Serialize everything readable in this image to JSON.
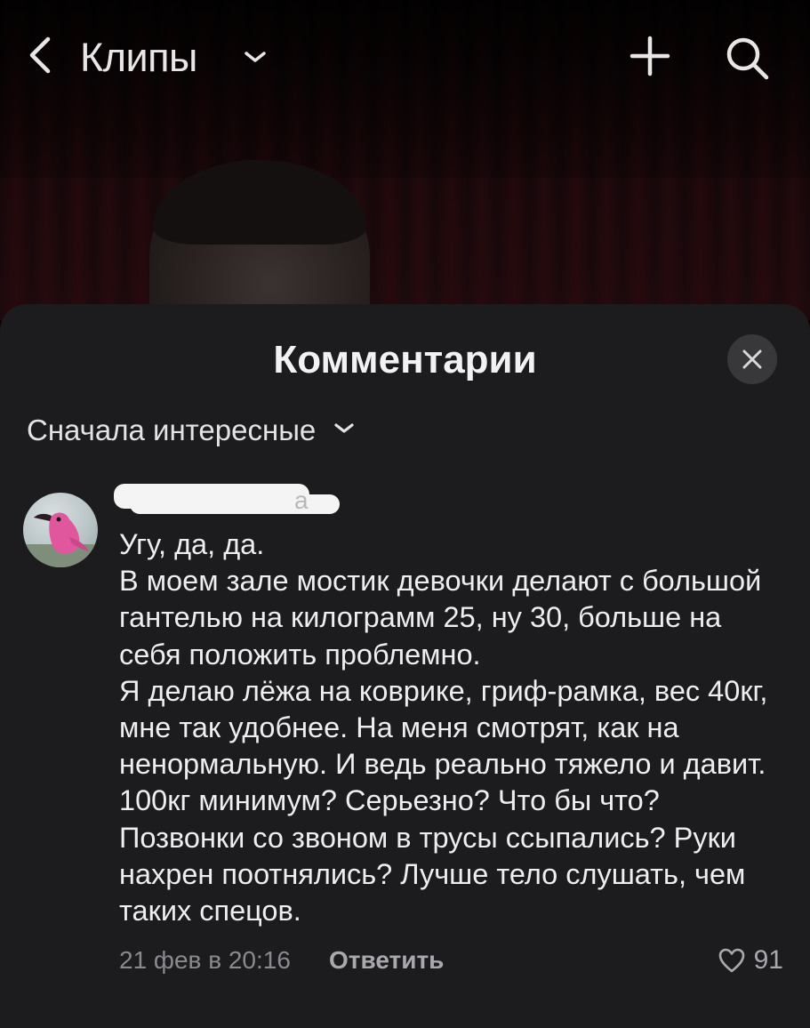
{
  "topbar": {
    "title": "Клипы",
    "back_icon": "chevron-left-icon",
    "title_dropdown_icon": "chevron-down-icon",
    "add_icon": "plus-icon",
    "search_icon": "search-icon"
  },
  "comments_sheet": {
    "title": "Комментарии",
    "close_icon": "close-icon",
    "sort": {
      "selected": "Сначала интересные",
      "dropdown_icon": "chevron-down-icon"
    },
    "comments": [
      {
        "username": "а",
        "avatar": "pink-crow-avatar",
        "text": "Угу, да, да.\nВ моем зале мостик девочки делают с большой гантелью на килограмм 25, ну 30, больше на себя положить проблемно.\nЯ делаю лёжа на коврике, гриф-рамка, вес 40кг, мне так удобнее. На меня смотрят, как на ненормальную. И ведь реально тяжело и давит.\n100кг минимум? Серьезно? Что бы что? Позвонки со звоном в трусы ссыпались? Руки нахрен поотнялись? Лучше тело слушать, чем таких спецов.",
        "date": "21 фев в 20:16",
        "reply_label": "Ответить",
        "likes": "91"
      }
    ]
  },
  "colors": {
    "sheet_bg": "#1c1c1e",
    "text_primary": "#eeeef0",
    "text_secondary": "#8a8a8e",
    "close_button_bg": "#38383b"
  }
}
